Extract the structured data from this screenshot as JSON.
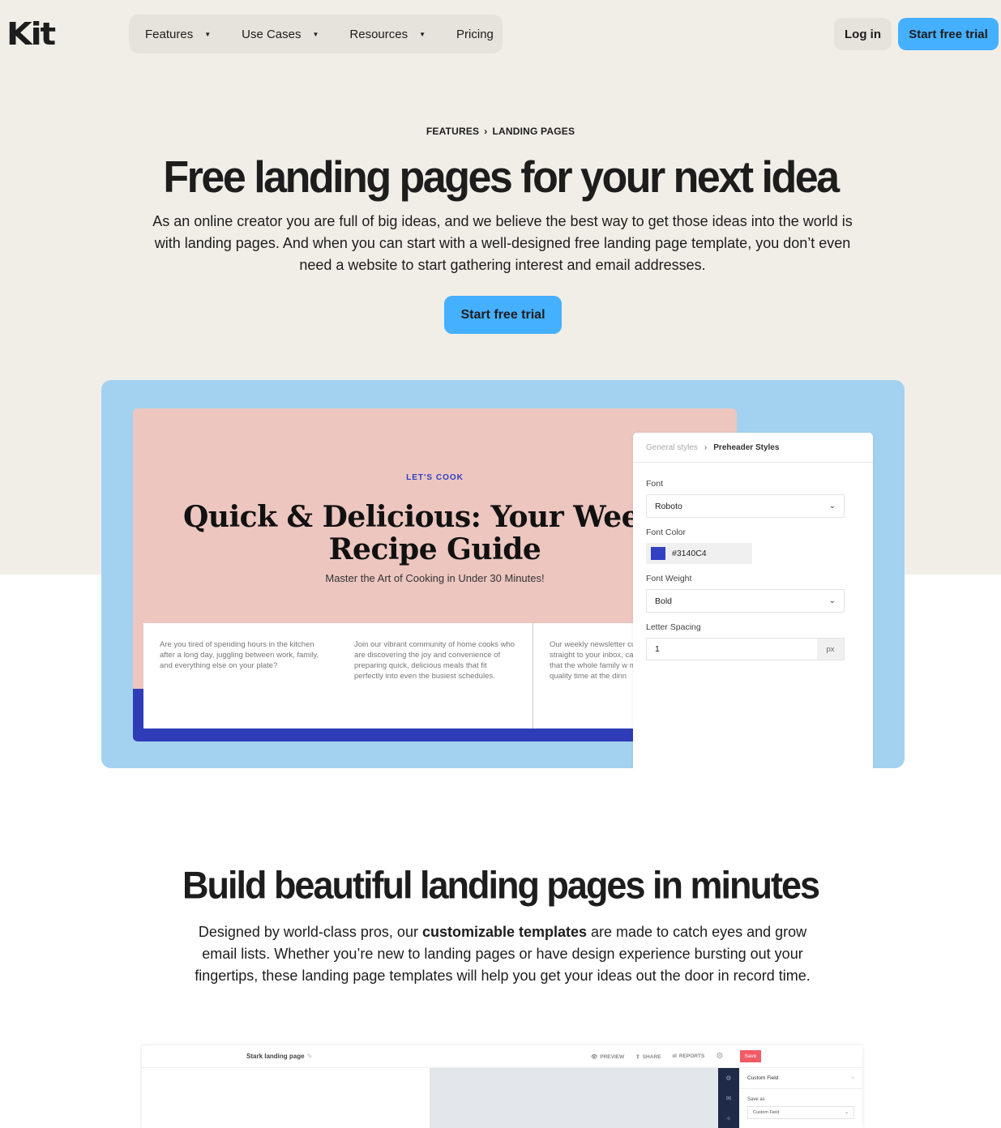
{
  "header": {
    "logo": "Kit",
    "nav": [
      {
        "label": "Features",
        "has_dropdown": true
      },
      {
        "label": "Use Cases",
        "has_dropdown": true
      },
      {
        "label": "Resources",
        "has_dropdown": true
      },
      {
        "label": "Pricing",
        "has_dropdown": false
      }
    ],
    "login_label": "Log in",
    "trial_label": "Start free trial",
    "caret_glyph": "▼"
  },
  "hero": {
    "breadcrumb": [
      "FEATURES",
      "LANDING PAGES"
    ],
    "breadcrumb_sep": "›",
    "title": "Free landing pages for your next idea",
    "description": "As an online creator you are full of big ideas, and we believe the best way to get those ideas into the world is with landing pages. And when you can start with a well-designed free landing page template, you don’t even need a website to start gathering interest and email addresses.",
    "cta_label": "Start free trial"
  },
  "showcase": {
    "landing_page": {
      "preheader": "LET'S COOK",
      "title": "Quick & Delicious: Your Weekly Recipe Guide",
      "subtitle": "Master the Art of Cooking in Under 30 Minutes!",
      "columns": [
        "Are you tired of spending hours in the kitchen after a long day, juggling between work, family, and everything else on your plate?",
        "Join our vibrant community of home cooks who are discovering the joy and convenience of preparing quick, delicious meals that fit perfectly into even the busiest schedules.",
        "Our weekly newsletter curated selection of ea straight to your inbox, can whip up satisfying that the whole family w minutes or less, allowi quality time at the dinn"
      ]
    },
    "style_panel": {
      "breadcrumb_parent": "General styles",
      "breadcrumb_sep": "›",
      "breadcrumb_current": "Preheader Styles",
      "font_label": "Font",
      "font_value": "Roboto",
      "font_color_label": "Font Color",
      "font_color_value": "#3140C4",
      "font_weight_label": "Font Weight",
      "font_weight_value": "Bold",
      "letter_spacing_label": "Letter Spacing",
      "letter_spacing_value": "1",
      "letter_spacing_unit": "px",
      "chevron_glyph": "⌄"
    }
  },
  "section2": {
    "title": "Build beautiful landing pages in minutes",
    "desc_before": "Designed by world-class pros, our ",
    "desc_bold": "customizable templates",
    "desc_after": " are made to catch eyes and grow email lists. Whether you’re new to landing pages or have design experience bursting out your fingertips, these landing page templates will help you get your ideas out the door in record time."
  },
  "editor": {
    "page_name": "Stark landing page",
    "actions": [
      "PREVIEW",
      "SHARE",
      "REPORTS"
    ],
    "action_icons": [
      "👁",
      "⇪",
      "ıll"
    ],
    "save_label": "Save",
    "side_title": "Custom Field",
    "side_close": "×",
    "save_as_label": "Save as",
    "save_as_value": "Custom Field"
  },
  "colors": {
    "accent_blue": "#45b0ff",
    "beige": "#f1eee8",
    "showcase_blue": "#a3d2f1",
    "recipe_pink": "#ecc6bf",
    "recipe_navy": "#2f3cb8",
    "save_red": "#f25a66"
  }
}
